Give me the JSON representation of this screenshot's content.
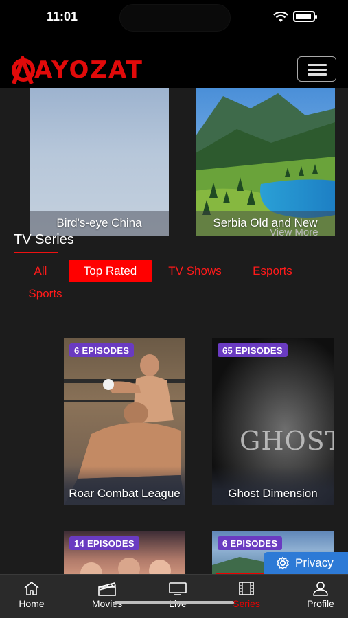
{
  "status_bar": {
    "time": "11:01"
  },
  "header": {
    "brand": "AYOZAT"
  },
  "featured": [
    {
      "title": "Bird's-eye China"
    },
    {
      "title": "Serbia Old and New"
    }
  ],
  "featured_view_more": "View More",
  "section": {
    "title": "TV Series"
  },
  "filters": {
    "all": "All",
    "top_rated": "Top Rated",
    "tv_shows": "TV Shows",
    "esports": "Esports",
    "sports": "Sports",
    "active": "Top Rated"
  },
  "series": [
    {
      "episodes": "6 EPISODES",
      "title": "Roar Combat League"
    },
    {
      "episodes": "65 EPISODES",
      "title": "Ghost Dimension"
    },
    {
      "episodes": "14 EPISODES",
      "title": ""
    },
    {
      "episodes": "6 EPISODES",
      "title": ""
    }
  ],
  "ghost_art_text": "GHOST",
  "privacy": {
    "label": "Privacy"
  },
  "bottom_nav": [
    {
      "label": "Home",
      "icon": "home-icon"
    },
    {
      "label": "Movies",
      "icon": "clapperboard-icon"
    },
    {
      "label": "Live",
      "icon": "tv-icon"
    },
    {
      "label": "Series",
      "icon": "film-icon",
      "active": true
    },
    {
      "label": "Profile",
      "icon": "user-icon"
    }
  ],
  "colors": {
    "brand_red": "#e10a0a",
    "accent_red": "#ff0000",
    "badge_purple": "#6a3bc1",
    "privacy_blue": "#2d7ad6"
  }
}
